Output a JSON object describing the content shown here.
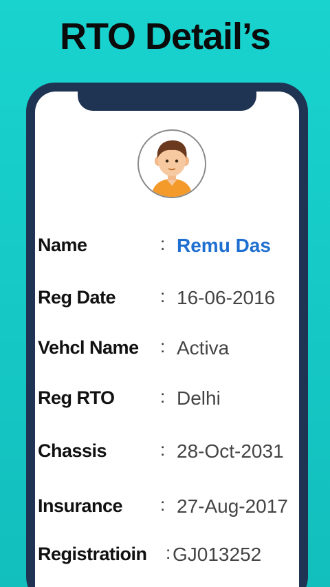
{
  "header": {
    "title": "RTO Detail’s"
  },
  "profile": {
    "avatar_icon": "user-avatar-icon"
  },
  "details": [
    {
      "label": "Name",
      "value": "Remu Das",
      "highlight": true
    },
    {
      "label": "Reg Date",
      "value": "16-06-2016"
    },
    {
      "label": "Vehcl Name",
      "value": "Activa"
    },
    {
      "label": "Reg RTO",
      "value": "Delhi"
    },
    {
      "label": "Chassis",
      "value": "28-Oct-2031"
    },
    {
      "label": "Insurance",
      "value": "27-Aug-2017"
    },
    {
      "label": "Registratioin",
      "value": "GJ013252"
    }
  ],
  "separator": ":",
  "colors": {
    "background": "#19d3cf",
    "phone_frame": "#1f3453",
    "highlight_value": "#1f6fd1"
  }
}
